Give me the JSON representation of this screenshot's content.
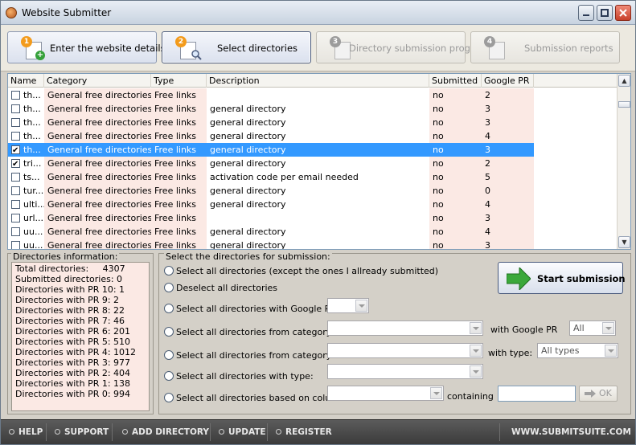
{
  "window": {
    "title": "Website Submitter"
  },
  "toolbar": {
    "steps": [
      {
        "number": "1",
        "label": "Enter the website details",
        "enabled": true
      },
      {
        "number": "2",
        "label": "Select directories",
        "enabled": true
      },
      {
        "number": "3",
        "label": "Directory submission progress",
        "enabled": false
      },
      {
        "number": "4",
        "label": "Submission reports",
        "enabled": false
      }
    ]
  },
  "grid": {
    "columns": [
      "Name",
      "Category",
      "Type",
      "Description",
      "Submitted",
      "Google PR"
    ],
    "rows": [
      {
        "checked": false,
        "name": "th...",
        "category": "General free directories",
        "type": "Free links",
        "description": "",
        "submitted": "no",
        "pr": "2"
      },
      {
        "checked": false,
        "name": "th...",
        "category": "General free directories",
        "type": "Free links",
        "description": "general directory",
        "submitted": "no",
        "pr": "3"
      },
      {
        "checked": false,
        "name": "th...",
        "category": "General free directories",
        "type": "Free links",
        "description": "general directory",
        "submitted": "no",
        "pr": "3"
      },
      {
        "checked": false,
        "name": "th...",
        "category": "General free directories",
        "type": "Free links",
        "description": "general directory",
        "submitted": "no",
        "pr": "4"
      },
      {
        "checked": true,
        "name": "th...",
        "category": "General free directories",
        "type": "Free links",
        "description": "general directory",
        "submitted": "no",
        "pr": "3",
        "selected": true
      },
      {
        "checked": true,
        "name": "tri...",
        "category": "General free directories",
        "type": "Free links",
        "description": "general directory",
        "submitted": "no",
        "pr": "2"
      },
      {
        "checked": false,
        "name": "ts...",
        "category": "General free directories",
        "type": "Free links",
        "description": "activation code per email needed",
        "submitted": "no",
        "pr": "5"
      },
      {
        "checked": false,
        "name": "tur...",
        "category": "General free directories",
        "type": "Free links",
        "description": "general directory",
        "submitted": "no",
        "pr": "0"
      },
      {
        "checked": false,
        "name": "ulti...",
        "category": "General free directories",
        "type": "Free links",
        "description": "general directory",
        "submitted": "no",
        "pr": "4"
      },
      {
        "checked": false,
        "name": "url...",
        "category": "General free directories",
        "type": "Free links",
        "description": "",
        "submitted": "no",
        "pr": "3"
      },
      {
        "checked": false,
        "name": "uu...",
        "category": "General free directories",
        "type": "Free links",
        "description": "general directory",
        "submitted": "no",
        "pr": "4"
      },
      {
        "checked": false,
        "name": "uu...",
        "category": "General free directories",
        "type": "Free links",
        "description": "general directory",
        "submitted": "no",
        "pr": "3"
      }
    ]
  },
  "info": {
    "legend": "Directories information:",
    "lines": [
      "Total directories:     4307",
      "Submitted directories: 0",
      "Directories with PR 10: 1",
      "Directories with PR 9: 2",
      "Directories with PR 8: 22",
      "Directories with PR 7: 46",
      "Directories with PR 6: 201",
      "Directories with PR 5: 510",
      "Directories with PR 4: 1012",
      "Directories with PR 3: 977",
      "Directories with PR 2: 404",
      "Directories with PR 1: 138",
      "Directories with PR 0: 994"
    ]
  },
  "selection": {
    "legend": "Select the directories for submission:",
    "options": {
      "all_except": "Select all directories (except the ones I allready submitted)",
      "deselect": "Deselect all directories",
      "by_pr": "Select all directories with Google PR:",
      "by_category_pr": "Select all directories from category:",
      "by_category_type": "Select all directories from category:",
      "by_type": "Select all directories with type:",
      "by_column": "Select all directories based on column:"
    },
    "with_google_pr_label": "with Google PR",
    "with_type_label": "with type:",
    "containing_label": "containing",
    "pr_filter_value": "All",
    "type_filter_value": "All types",
    "ok_label": "OK",
    "start_label": "Start submission"
  },
  "footer": {
    "items": [
      "HELP",
      "SUPPORT",
      "ADD DIRECTORY",
      "UPDATE",
      "REGISTER"
    ],
    "site": "WWW.SUBMITSUITE.COM"
  },
  "colors": {
    "selection": "#3399ff",
    "tint": "#fbe9e4",
    "footer": "#4a4a4a",
    "step_number": "#f39b1c",
    "start_arrow": "#3aa83a"
  }
}
